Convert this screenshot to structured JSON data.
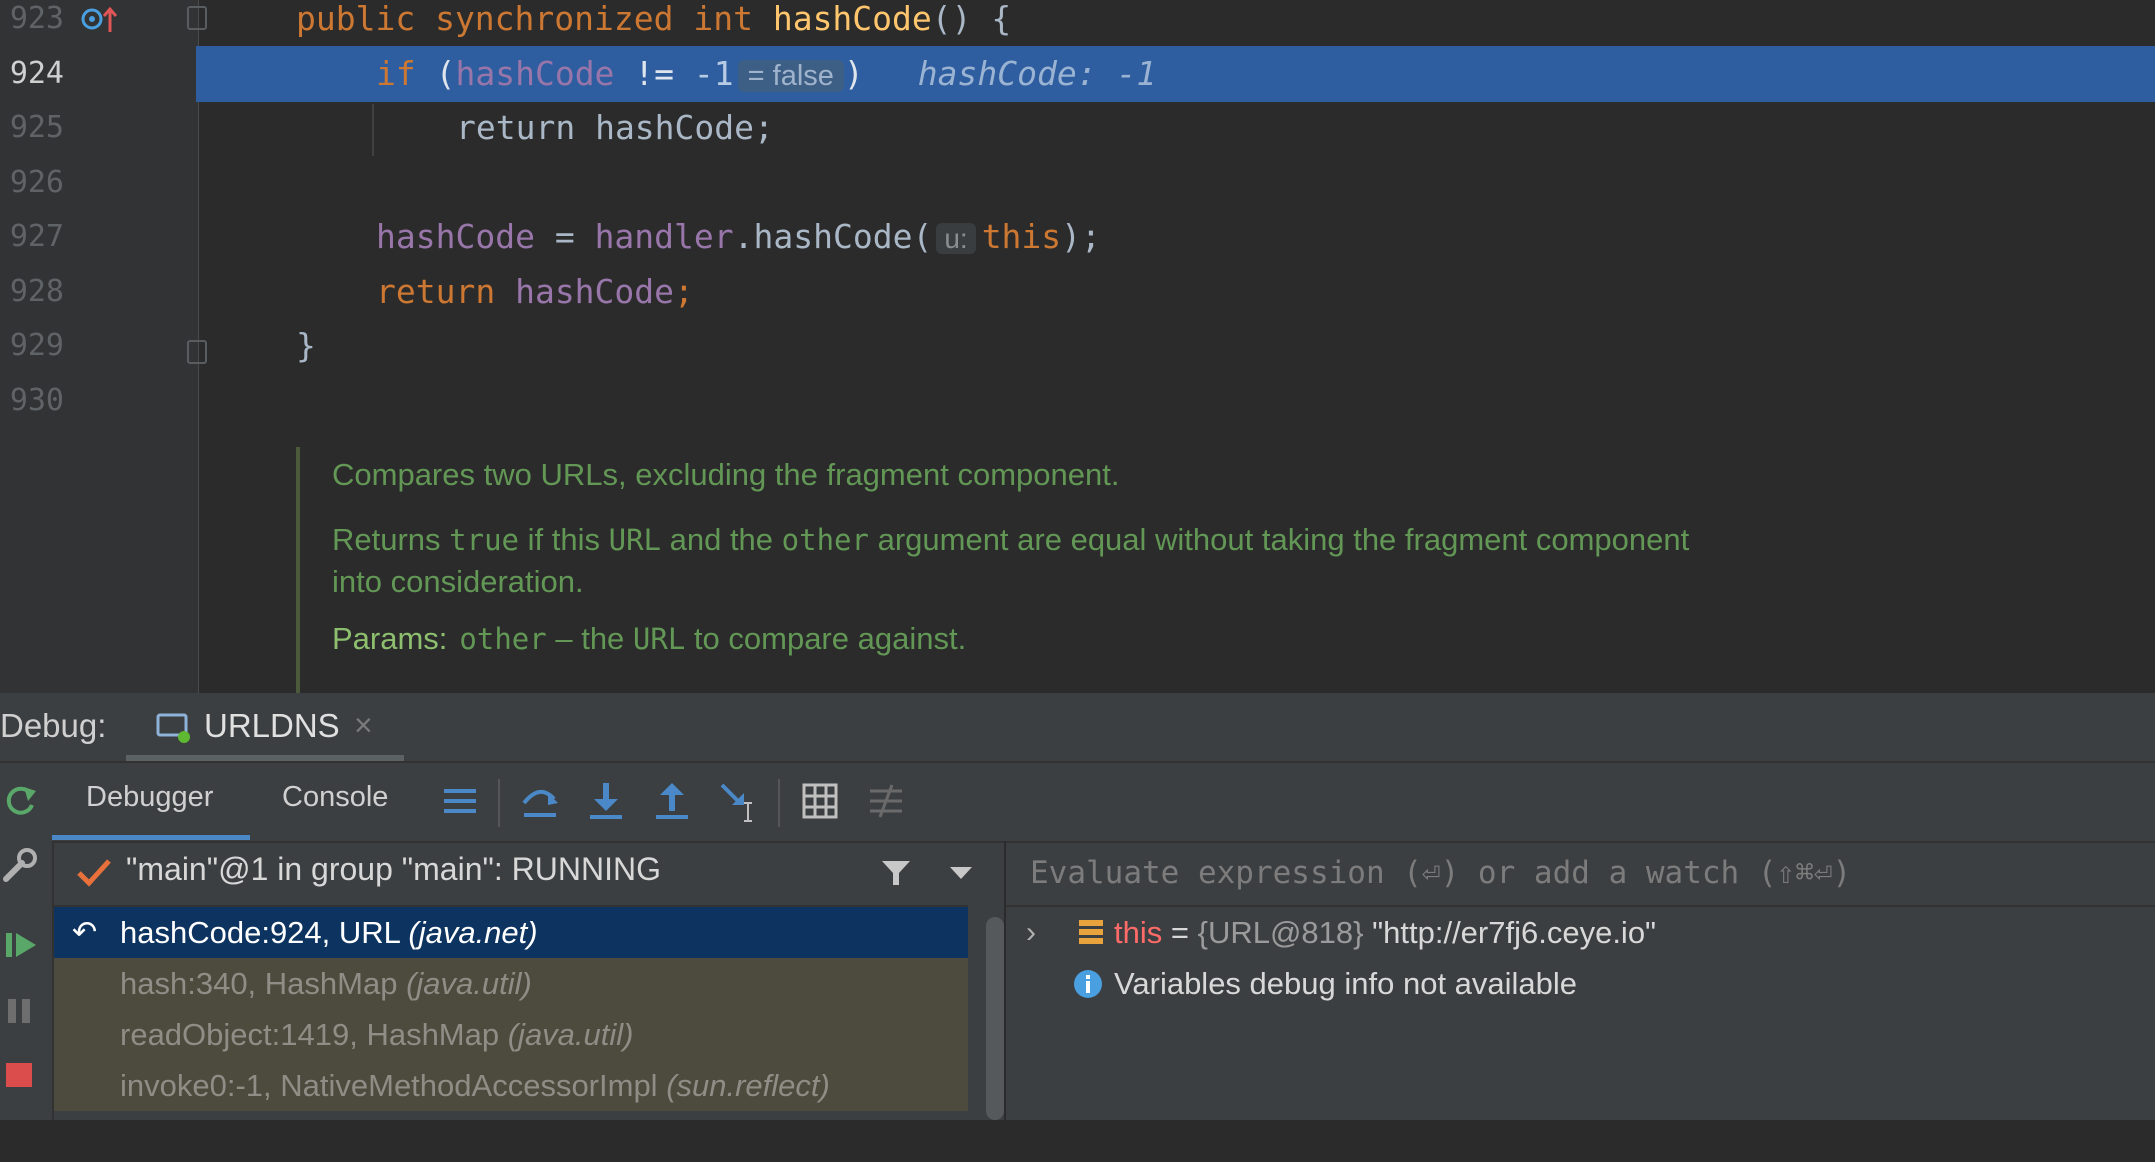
{
  "editor": {
    "lines": [
      {
        "no": "923",
        "tokens": [
          {
            "t": "public synchronized int ",
            "c": "kw"
          },
          {
            "t": "hashCode",
            "c": "fn"
          },
          {
            "t": "() {",
            "c": "pl"
          }
        ]
      },
      {
        "no": "924",
        "highlighted": true,
        "tokens": [
          {
            "t": "if ",
            "c": "kw"
          },
          {
            "t": "(",
            "c": "pl"
          },
          {
            "t": "hashCode",
            "c": "fld"
          },
          {
            "t": " != ",
            "c": "pl"
          },
          {
            "t": "-1",
            "c": "num"
          }
        ],
        "inline_value": "= false",
        "after": ")",
        "debug_value": "hashCode: -1"
      },
      {
        "no": "925",
        "tokens": [
          {
            "t": "return hashCode;",
            "c": "pl"
          }
        ]
      },
      {
        "no": "926",
        "tokens": []
      },
      {
        "no": "927",
        "tokens": [
          {
            "t": "hashCode",
            "c": "fld"
          },
          {
            "t": " = ",
            "c": "pl"
          },
          {
            "t": "handler",
            "c": "fld"
          },
          {
            "t": ".hashCode(",
            "c": "pl"
          }
        ],
        "param_hint": "u:",
        "after_tokens": [
          {
            "t": "this",
            "c": "kw"
          },
          {
            "t": ");",
            "c": "pl"
          }
        ]
      },
      {
        "no": "928",
        "tokens": [
          {
            "t": "return ",
            "c": "kw"
          },
          {
            "t": "hashCode",
            "c": "fld"
          },
          {
            "t": ";",
            "c": "kw"
          }
        ]
      },
      {
        "no": "929",
        "tokens": [
          {
            "t": "}",
            "c": "pl"
          }
        ]
      },
      {
        "no": "930",
        "tokens": []
      }
    ],
    "doc": {
      "summary": "Compares two URLs, excluding the fragment component.",
      "returns_prefix": "Returns ",
      "returns_true": "true",
      "returns_mid1": " if this ",
      "returns_url": "URL",
      "returns_mid2": " and the ",
      "returns_other": "other",
      "returns_rest": " argument are equal without taking the fragment component",
      "returns_line2": "into consideration.",
      "params_label": "Params:",
      "params_name": "other",
      "params_dash": " – the ",
      "params_url": "URL",
      "params_rest": " to compare against."
    }
  },
  "debug": {
    "label": "Debug:",
    "session_tab": "URLDNS",
    "tabs": [
      "Debugger",
      "Console"
    ],
    "thread": "\"main\"@1 in group \"main\": RUNNING",
    "frames": [
      {
        "method": "hashCode:924, URL ",
        "pkg": "(java.net)",
        "selected": true
      },
      {
        "method": "hash:340, HashMap ",
        "pkg": "(java.util)"
      },
      {
        "method": "readObject:1419, HashMap ",
        "pkg": "(java.util)"
      },
      {
        "method": "invoke0:-1, NativeMethodAccessorImpl ",
        "pkg": "(sun.reflect)"
      }
    ],
    "eval_placeholder": "Evaluate expression (⏎) or add a watch (⇧⌘⏎)",
    "variables": {
      "this_name": "this",
      "this_eq": " = ",
      "this_type": "{URL@818}",
      "this_value": " \"http://er7fj6.ceye.io\"",
      "info": "Variables debug info not available"
    }
  },
  "colors": {
    "keyword": "#cc7832",
    "field": "#9876aa",
    "method": "#ffc66d",
    "highlight_line": "#2e5e9f",
    "doc_comment": "#629755",
    "selected_frame": "#0d3460",
    "frame_bg": "#4d4a3e",
    "debug_accent": "#4a88c7"
  }
}
